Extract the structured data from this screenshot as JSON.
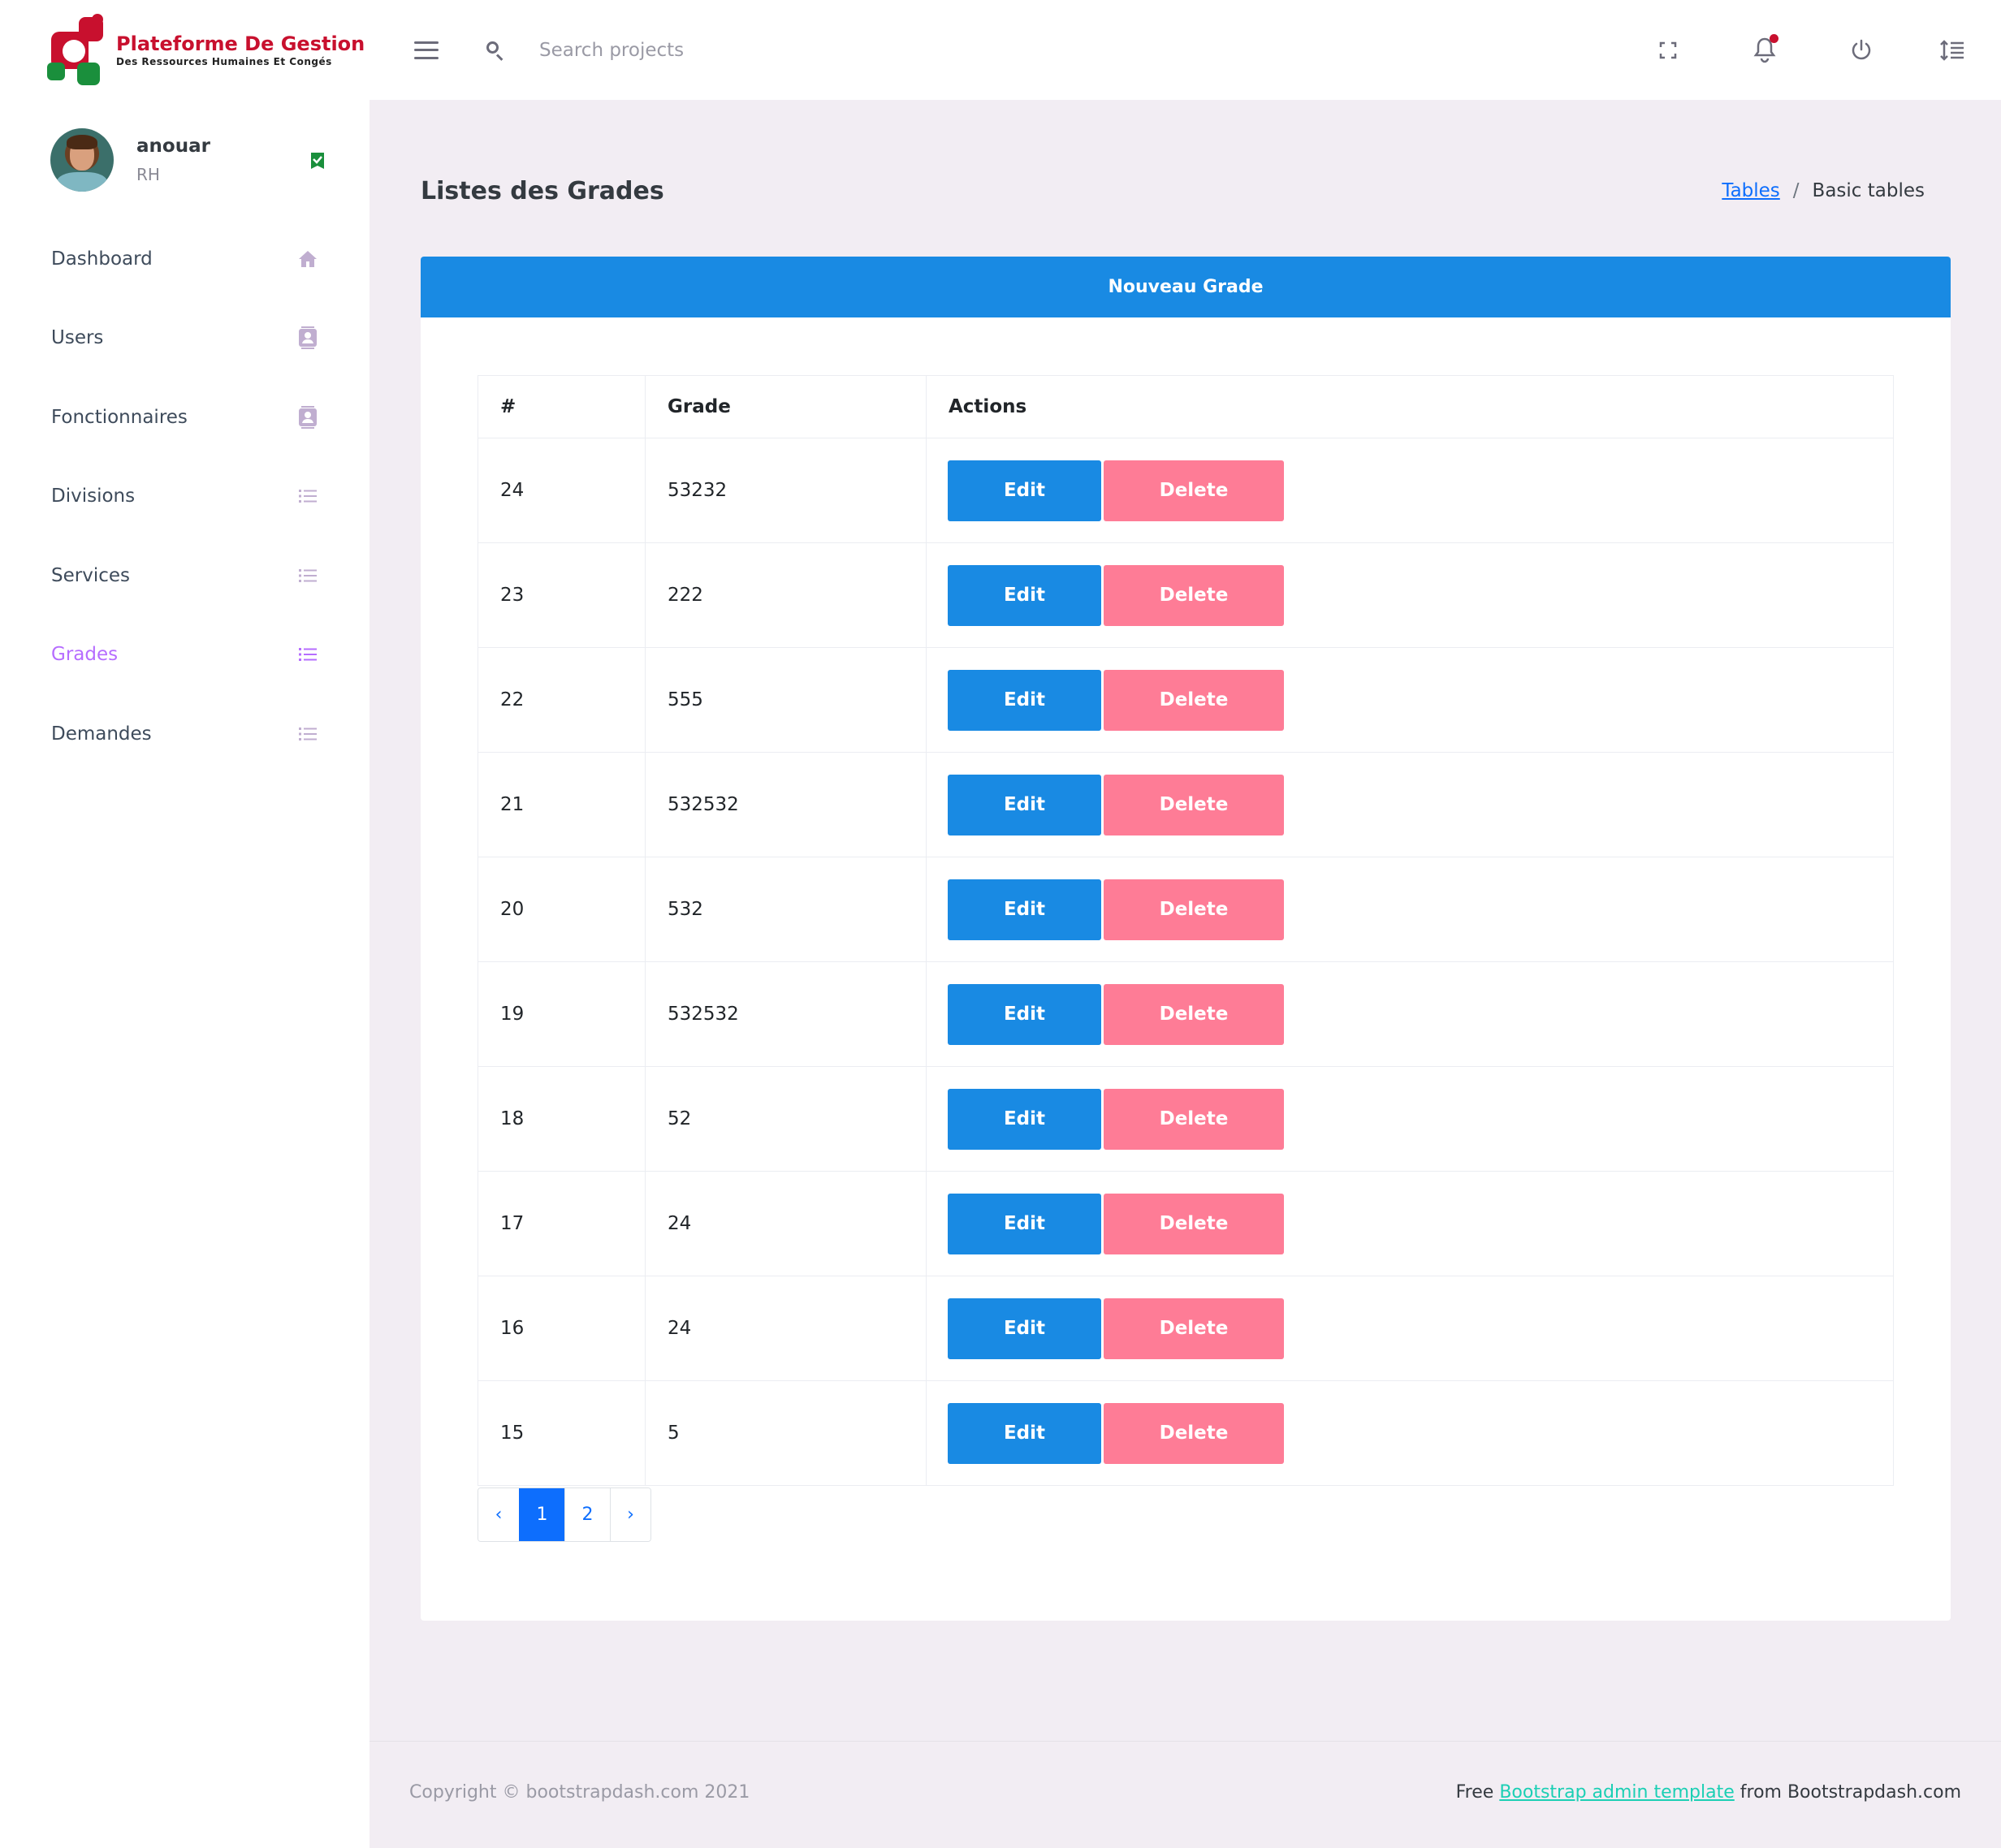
{
  "brand": {
    "title": "Plateforme De Gestion",
    "subtitle": "Des Ressources Humaines Et Congés"
  },
  "search": {
    "placeholder": "Search projects"
  },
  "topbar_icons": [
    "menu-icon",
    "search-icon",
    "fullscreen-icon",
    "bell-icon",
    "power-icon",
    "settings-icon"
  ],
  "profile": {
    "name": "anouar",
    "role": "RH"
  },
  "sidebar": {
    "items": [
      {
        "label": "Dashboard",
        "icon": "home-icon",
        "active": false
      },
      {
        "label": "Users",
        "icon": "contact-card-icon",
        "active": false
      },
      {
        "label": "Fonctionnaires",
        "icon": "contact-card-icon",
        "active": false
      },
      {
        "label": "Divisions",
        "icon": "list-icon",
        "active": false
      },
      {
        "label": "Services",
        "icon": "list-icon",
        "active": false
      },
      {
        "label": "Grades",
        "icon": "list-icon",
        "active": true
      },
      {
        "label": "Demandes",
        "icon": "list-icon",
        "active": false
      }
    ]
  },
  "page": {
    "title": "Listes des Grades"
  },
  "breadcrumb": {
    "link": "Tables",
    "separator": "/",
    "current": "Basic tables"
  },
  "card": {
    "new_button": "Nouveau Grade"
  },
  "table": {
    "headers": [
      "#",
      "Grade",
      "Actions"
    ],
    "edit_label": "Edit",
    "delete_label": "Delete",
    "rows": [
      {
        "id": "24",
        "grade": "53232"
      },
      {
        "id": "23",
        "grade": "222"
      },
      {
        "id": "22",
        "grade": "555"
      },
      {
        "id": "21",
        "grade": "532532"
      },
      {
        "id": "20",
        "grade": "532"
      },
      {
        "id": "19",
        "grade": "532532"
      },
      {
        "id": "18",
        "grade": "52"
      },
      {
        "id": "17",
        "grade": "24"
      },
      {
        "id": "16",
        "grade": "24"
      },
      {
        "id": "15",
        "grade": "5"
      }
    ]
  },
  "pagination": {
    "prev": "‹",
    "pages": [
      "1",
      "2"
    ],
    "active": "1",
    "next": "›"
  },
  "footer": {
    "copyright": "Copyright © bootstrapdash.com 2021",
    "credit_prefix": "Free ",
    "credit_link": "Bootstrap admin template",
    "credit_suffix": " from Bootstrapdash.com"
  },
  "colors": {
    "primary": "#198ae3",
    "danger": "#fe7c96",
    "active_menu": "#b66dff",
    "notification_dot": "#c8102e",
    "brand_red": "#c8102e",
    "brand_green": "#1a8f3c"
  }
}
